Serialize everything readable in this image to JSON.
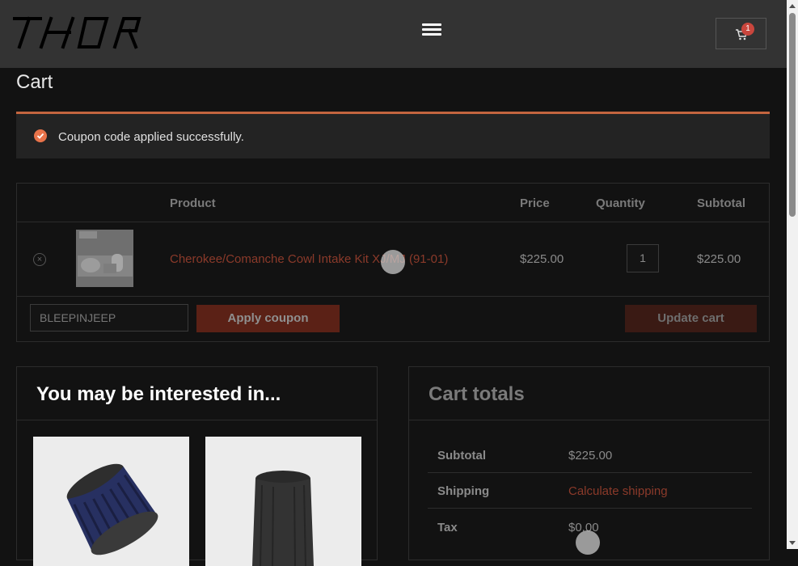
{
  "brand": {
    "logo_text": "THOR"
  },
  "header": {
    "cart_count": "1"
  },
  "page": {
    "title": "Cart"
  },
  "notice": {
    "message": "Coupon code applied successfully."
  },
  "cart_table": {
    "headers": {
      "product": "Product",
      "price": "Price",
      "quantity": "Quantity",
      "subtotal": "Subtotal"
    },
    "items": [
      {
        "name": "Cherokee/Comanche Cowl Intake Kit XJ/MJ (91-01)",
        "price": "$225.00",
        "quantity": "1",
        "subtotal": "$225.00"
      }
    ],
    "remove_symbol": "×"
  },
  "coupon": {
    "value": "BLEEPINJEEP",
    "apply_label": "Apply coupon",
    "update_label": "Update cart"
  },
  "recommendations": {
    "title": "You may be interested in..."
  },
  "totals": {
    "title": "Cart totals",
    "subtotal_label": "Subtotal",
    "subtotal_value": "$225.00",
    "shipping_label": "Shipping",
    "shipping_link": "Calculate shipping",
    "tax_label": "Tax",
    "tax_value": "$0.00"
  },
  "colors": {
    "accent": "#c3653f",
    "link": "#8b3a2a",
    "header_bg": "#333333",
    "page_bg": "#121212"
  }
}
